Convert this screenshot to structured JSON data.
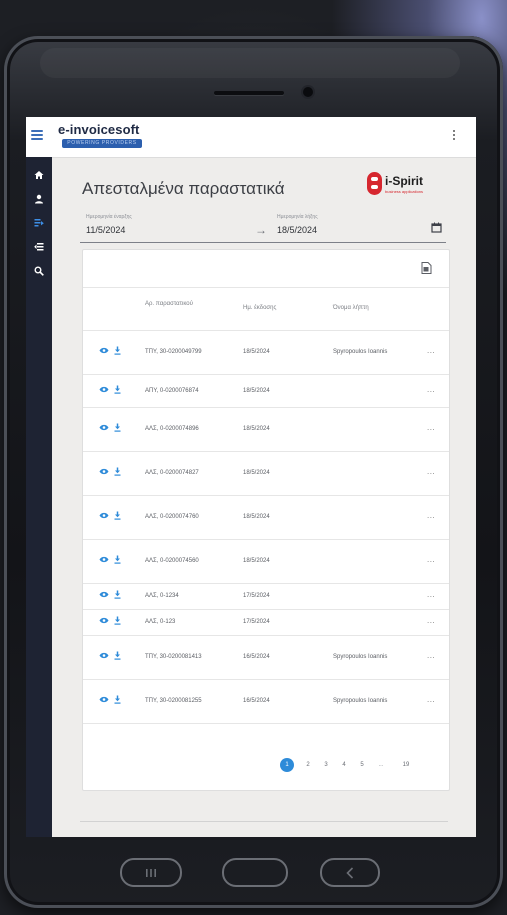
{
  "app": {
    "logo": "e-invoicesoft",
    "logo_tagline": "POWERING PROVIDERS"
  },
  "page": {
    "title": "Απεσταλμένα παραστατικά",
    "brand_name": "i-Spirit",
    "brand_sub": "business applications"
  },
  "filters": {
    "start_label": "Ημερομηνία έναρξης",
    "start_value": "11/5/2024",
    "end_label": "Ημερομηνία λήξης",
    "end_value": "18/5/2024"
  },
  "table": {
    "headers": [
      "Αρ. παραστατικού",
      "Ημ. έκδοσης",
      "Όνομα λήπτη"
    ],
    "rows": [
      {
        "doc": "ΤΠΥ, 30-0200049799",
        "date": "18/5/2024",
        "recipient": "Spyropoulos Ioannis"
      },
      {
        "doc": "ΑΠΥ, 0-0200076874",
        "date": "18/5/2024",
        "recipient": ""
      },
      {
        "doc": "ΑΛΣ, 0-0200074896",
        "date": "18/5/2024",
        "recipient": ""
      },
      {
        "doc": "ΑΛΣ, 0-0200074827",
        "date": "18/5/2024",
        "recipient": ""
      },
      {
        "doc": "ΑΛΣ, 0-0200074760",
        "date": "18/5/2024",
        "recipient": ""
      },
      {
        "doc": "ΑΛΣ, 0-0200074560",
        "date": "18/5/2024",
        "recipient": ""
      },
      {
        "doc": "ΑΛΣ, 0-1234",
        "date": "17/5/2024",
        "recipient": ""
      },
      {
        "doc": "ΑΛΣ, 0-123",
        "date": "17/5/2024",
        "recipient": ""
      },
      {
        "doc": "ΤΠΥ, 30-0200081413",
        "date": "16/5/2024",
        "recipient": "Spyropoulos Ioannis"
      },
      {
        "doc": "ΤΠΥ, 30-0200081255",
        "date": "16/5/2024",
        "recipient": "Spyropoulos Ioannis"
      }
    ],
    "more_label": "..."
  },
  "pagination": {
    "pages": [
      "1",
      "2",
      "3",
      "4",
      "5"
    ],
    "ellipsis": "...",
    "last": "19",
    "current": 1
  },
  "icons": {
    "sidebar": [
      "home-icon",
      "user-icon",
      "invoice-icon",
      "send-list-icon",
      "search-icon"
    ],
    "row": [
      "eye-icon",
      "download-icon"
    ]
  },
  "colors": {
    "accent": "#2e8bd9",
    "sidebar": "#1e2333",
    "brand_red": "#d6272f"
  }
}
